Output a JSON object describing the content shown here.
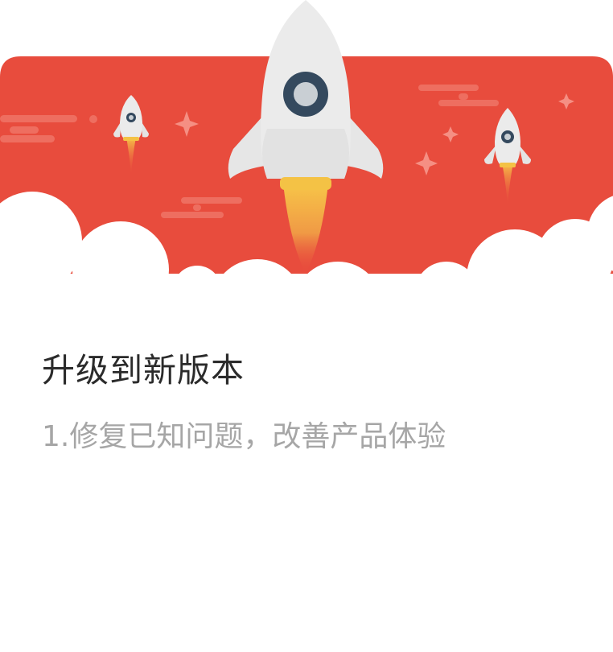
{
  "colors": {
    "banner_red": "#e84c3d",
    "title_text": "#2b2b2b",
    "note_text": "#a6a6a6",
    "rocket_body": "#ebebeb",
    "rocket_window": "#34495e"
  },
  "icons": {
    "main_rocket": "rocket-icon",
    "small_rockets": "rocket-icon",
    "sparkles": "sparkle-icon",
    "clouds": "cloud-shape"
  },
  "update": {
    "title": "升级到新版本",
    "notes": [
      "1.修复已知问题，改善产品体验"
    ]
  }
}
